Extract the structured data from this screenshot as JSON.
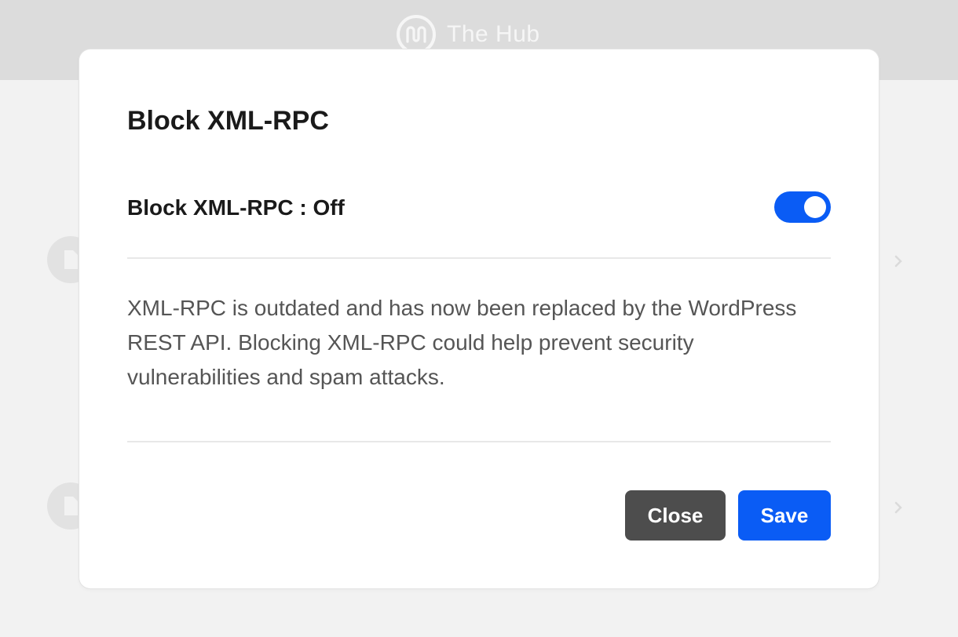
{
  "app": {
    "brand_name": "The Hub"
  },
  "modal": {
    "title": "Block XML-RPC",
    "setting_label": "Block XML-RPC : Off",
    "toggle_on": true,
    "description": "XML-RPC is outdated and has now been replaced by the WordPress REST API. Blocking XML-RPC could help prevent security vulnerabilities and spam attacks.",
    "close_label": "Close",
    "save_label": "Save"
  },
  "colors": {
    "accent": "#0a5cf5",
    "close_button": "#4d4d4d",
    "header_bg": "#dcdcdc",
    "page_bg": "#f2f2f2"
  },
  "icons": {
    "brand": "hub-logo-icon",
    "row": "document-icon",
    "chevron": "chevron-right-icon"
  }
}
